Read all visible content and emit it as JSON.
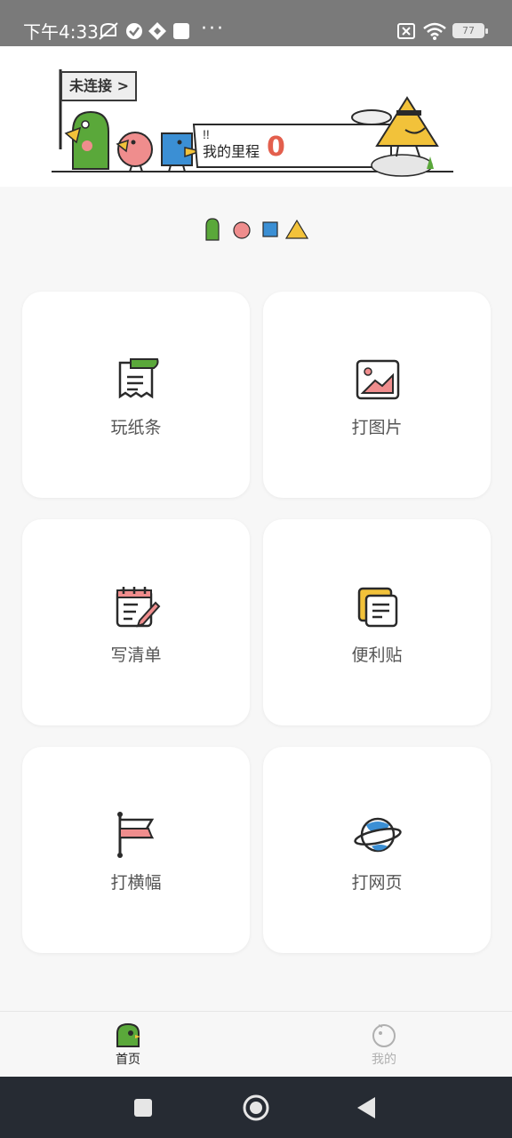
{
  "status_bar": {
    "time": "下午4:33",
    "more": "···",
    "battery": "77"
  },
  "banner": {
    "connect_label": "未连接 >",
    "exclaim": "!!",
    "mileage_label": "我的里程",
    "mileage_value": "0"
  },
  "grid": {
    "items": [
      {
        "label": "玩纸条",
        "icon": "paper-strip-icon"
      },
      {
        "label": "打图片",
        "icon": "image-icon"
      },
      {
        "label": "写清单",
        "icon": "checklist-icon"
      },
      {
        "label": "便利贴",
        "icon": "sticky-note-icon"
      },
      {
        "label": "打横幅",
        "icon": "banner-flag-icon"
      },
      {
        "label": "打网页",
        "icon": "planet-icon"
      }
    ]
  },
  "bottom_nav": {
    "home_label": "首页",
    "mine_label": "我的"
  },
  "colors": {
    "accent_red": "#e35f4d",
    "green_mascot": "#5aa83a",
    "blue_mascot": "#3b8fd4",
    "yellow_mascot": "#f2c23a",
    "pink_mascot": "#ef8d8d"
  }
}
